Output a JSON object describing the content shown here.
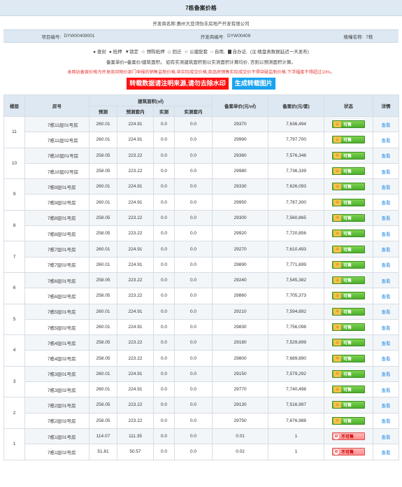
{
  "page": {
    "title": "7栋备案价格",
    "developer_label": "开发商名称:",
    "developer_name": "惠州大亚湾怡丰房地产开发有限公司"
  },
  "info": {
    "project_label": "项目编号:",
    "project_value": "DYW00409001",
    "dev_no_label": "开发商编号:",
    "dev_no_value": "DYW00409",
    "building_label": "楼幢名称:",
    "building_value": "7栋"
  },
  "legend": {
    "items": [
      "● 查封",
      "● 抵押",
      "▼锁定",
      "☆ 预购抵押",
      "◇ 回迁",
      "☆ 公建配套",
      "○ 自用,",
      "自办证,",
      "(注:楼盘表数据延迟一天发布)"
    ]
  },
  "formula": "备案单价=备案价/建筑面积。 如有实测建筑面积则以实测面积计算均价, 否则以预测面积计算。",
  "warning": "本网站备案价格为开发商向物价部门申报的销售监制价格,非实际成交价格,商品房销售实际成交价不得突破监制价格,下浮幅度不得超过10%。",
  "buttons": {
    "notice": "转载数据请注明来源,请勿去除水印",
    "generate": "生成转载图片"
  },
  "table": {
    "headers": {
      "floor": "楼层",
      "room": "房号",
      "area_group": "建筑面积(㎡)",
      "pred": "预测",
      "pred_inner": "预测套内",
      "actual": "实测",
      "actual_inner": "实测套内",
      "unit_price": "备案单价(元/㎡)",
      "total_price": "备案价(元/套)",
      "status": "状态",
      "detail": "详情"
    },
    "status_ok": "可售",
    "status_no": "不可售",
    "detail_label": "查看",
    "floors": [
      {
        "floor": "11",
        "rows": [
          {
            "room": "7栋11层01号房",
            "pred": "260.01",
            "pred_inner": "224.91",
            "actual": "0.0",
            "actual_inner": "0.0",
            "unit_price": "29370",
            "total_price": "7,636,494",
            "available": true
          },
          {
            "room": "7栋11层02号房",
            "pred": "260.01",
            "pred_inner": "224.91",
            "actual": "0.0",
            "actual_inner": "0.0",
            "unit_price": "29990",
            "total_price": "7,797,700",
            "available": true
          }
        ]
      },
      {
        "floor": "10",
        "rows": [
          {
            "room": "7栋10层01号房",
            "pred": "258.05",
            "pred_inner": "223.22",
            "actual": "0.0",
            "actual_inner": "0.0",
            "unit_price": "29360",
            "total_price": "7,576,348",
            "available": true
          },
          {
            "room": "7栋10层02号房",
            "pred": "258.05",
            "pred_inner": "223.22",
            "actual": "0.0",
            "actual_inner": "0.0",
            "unit_price": "29980",
            "total_price": "7,736,339",
            "available": true
          }
        ]
      },
      {
        "floor": "9",
        "rows": [
          {
            "room": "7栋9层01号房",
            "pred": "260.01",
            "pred_inner": "224.91",
            "actual": "0.0",
            "actual_inner": "0.0",
            "unit_price": "29330",
            "total_price": "7,626,093",
            "available": true
          },
          {
            "room": "7栋9层02号房",
            "pred": "260.01",
            "pred_inner": "224.91",
            "actual": "0.0",
            "actual_inner": "0.0",
            "unit_price": "29950",
            "total_price": "7,787,300",
            "available": true
          }
        ]
      },
      {
        "floor": "8",
        "rows": [
          {
            "room": "7栋8层01号房",
            "pred": "258.05",
            "pred_inner": "223.22",
            "actual": "0.0",
            "actual_inner": "0.0",
            "unit_price": "29300",
            "total_price": "7,560,865",
            "available": true
          },
          {
            "room": "7栋8层02号房",
            "pred": "258.05",
            "pred_inner": "223.22",
            "actual": "0.0",
            "actual_inner": "0.0",
            "unit_price": "29920",
            "total_price": "7,720,856",
            "available": true
          }
        ]
      },
      {
        "floor": "7",
        "rows": [
          {
            "room": "7栋7层01号房",
            "pred": "260.01",
            "pred_inner": "224.91",
            "actual": "0.0",
            "actual_inner": "0.0",
            "unit_price": "29270",
            "total_price": "7,610,493",
            "available": true
          },
          {
            "room": "7栋7层02号房",
            "pred": "260.01",
            "pred_inner": "224.91",
            "actual": "0.0",
            "actual_inner": "0.0",
            "unit_price": "29890",
            "total_price": "7,771,699",
            "available": true
          }
        ]
      },
      {
        "floor": "6",
        "rows": [
          {
            "room": "7栋6层01号房",
            "pred": "258.05",
            "pred_inner": "223.22",
            "actual": "0.0",
            "actual_inner": "0.0",
            "unit_price": "29240",
            "total_price": "7,545,382",
            "available": true
          },
          {
            "room": "7栋6层02号房",
            "pred": "258.05",
            "pred_inner": "223.22",
            "actual": "0.0",
            "actual_inner": "0.0",
            "unit_price": "29860",
            "total_price": "7,705,373",
            "available": true
          }
        ]
      },
      {
        "floor": "5",
        "rows": [
          {
            "room": "7栋5层01号房",
            "pred": "260.01",
            "pred_inner": "224.91",
            "actual": "0.0",
            "actual_inner": "0.0",
            "unit_price": "29210",
            "total_price": "7,594,892",
            "available": true
          },
          {
            "room": "7栋5层02号房",
            "pred": "260.01",
            "pred_inner": "224.91",
            "actual": "0.0",
            "actual_inner": "0.0",
            "unit_price": "29830",
            "total_price": "7,756,098",
            "available": true
          }
        ]
      },
      {
        "floor": "4",
        "rows": [
          {
            "room": "7栋4层01号房",
            "pred": "258.05",
            "pred_inner": "223.22",
            "actual": "0.0",
            "actual_inner": "0.0",
            "unit_price": "29180",
            "total_price": "7,529,899",
            "available": true
          },
          {
            "room": "7栋4层02号房",
            "pred": "258.05",
            "pred_inner": "223.22",
            "actual": "0.0",
            "actual_inner": "0.0",
            "unit_price": "29800",
            "total_price": "7,689,890",
            "available": true
          }
        ]
      },
      {
        "floor": "3",
        "rows": [
          {
            "room": "7栋3层01号房",
            "pred": "260.01",
            "pred_inner": "224.91",
            "actual": "0.0",
            "actual_inner": "0.0",
            "unit_price": "29150",
            "total_price": "7,579,292",
            "available": true
          },
          {
            "room": "7栋3层02号房",
            "pred": "260.01",
            "pred_inner": "224.91",
            "actual": "0.0",
            "actual_inner": "0.0",
            "unit_price": "29770",
            "total_price": "7,740,498",
            "available": true
          }
        ]
      },
      {
        "floor": "2",
        "rows": [
          {
            "room": "7栋2层01号房",
            "pred": "258.05",
            "pred_inner": "223.22",
            "actual": "0.0",
            "actual_inner": "0.0",
            "unit_price": "29130",
            "total_price": "7,516,997",
            "available": true
          },
          {
            "room": "7栋2层02号房",
            "pred": "258.05",
            "pred_inner": "223.22",
            "actual": "0.0",
            "actual_inner": "0.0",
            "unit_price": "29750",
            "total_price": "7,676,988",
            "available": true
          }
        ]
      },
      {
        "floor": "1",
        "rows": [
          {
            "room": "7栋1层01号房",
            "pred": "114.07",
            "pred_inner": "111.35",
            "actual": "0.0",
            "actual_inner": "0.0",
            "unit_price": "0.01",
            "total_price": "1",
            "available": false
          },
          {
            "room": "7栋1层02号房",
            "pred": "51.81",
            "pred_inner": "50.57",
            "actual": "0.0",
            "actual_inner": "0.0",
            "unit_price": "0.02",
            "total_price": "1",
            "available": false
          }
        ]
      }
    ]
  }
}
